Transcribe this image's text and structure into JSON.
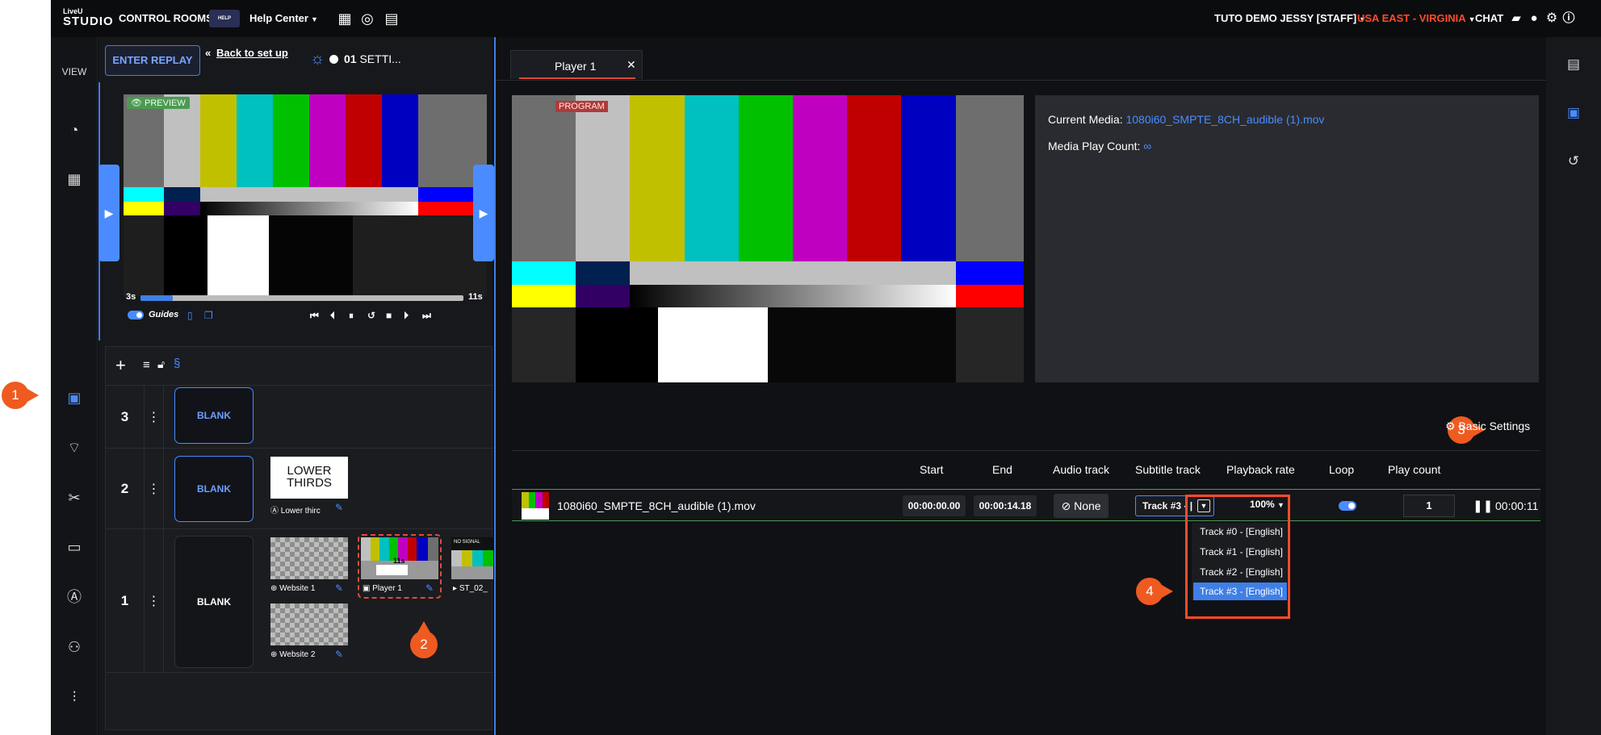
{
  "topbar": {
    "logo_top": "LiveU",
    "logo_bottom": "STUDIO",
    "control_rooms": "CONTROL ROOMS",
    "hc_badge": "HELP",
    "help_center": "Help Center",
    "user": "TUTO DEMO JESSY [STAFF]",
    "region": "USA EAST - VIRGINIA",
    "chat": "CHAT"
  },
  "rail": {
    "view_label": "VIEW",
    "icons": [
      "dashboard-icon",
      "layout-icon",
      "camera-icon",
      "broadcast-icon",
      "scissors-icon",
      "caption-icon",
      "text-icon",
      "users-icon",
      "sliders-icon"
    ]
  },
  "mid": {
    "enter_replay": "ENTER REPLAY",
    "back_to_set": "Back to set up",
    "scene_number": "01",
    "scene_name": "SETTI...",
    "preview_tag": "PREVIEW",
    "progress": {
      "current": "3s",
      "total": "11s",
      "fraction": 0.1
    },
    "guides_label": "Guides",
    "layers": [
      {
        "num": "3",
        "blank": "BLANK"
      },
      {
        "num": "2",
        "blank": "BLANK",
        "lower_thirds_title": "LOWER THIRDS",
        "lower_thirds_label": "Lower thirc"
      },
      {
        "num": "1",
        "blank": "BLANK",
        "website1": "Website 1",
        "website2": "Website 2",
        "player1": "Player 1",
        "player1_time": "11s",
        "st_label": "ST_02_",
        "no_signal": "NO SIGNAL"
      }
    ]
  },
  "player": {
    "tab_label": "Player 1",
    "program_tag": "PROGRAM",
    "current_media_label": "Current Media:",
    "current_media_value": "1080i60_SMPTE_8CH_audible (1).mov",
    "play_count_label": "Media Play Count:",
    "play_count_value": "∞",
    "basic_settings": "Basic Settings",
    "columns": {
      "start": "Start",
      "end": "End",
      "audio": "Audio track",
      "subtitle": "Subtitle track",
      "rate": "Playback rate",
      "loop": "Loop",
      "count": "Play count"
    },
    "row": {
      "filename": "1080i60_SMPTE_8CH_audible (1).mov",
      "start": "00:00:00.00",
      "end": "00:00:14.18",
      "audio": "None",
      "subtitle": "Track #3 - |",
      "rate": "100%",
      "count": "1",
      "time_left": "00:00:11"
    },
    "subtitle_options": [
      "Track #0 - [English]",
      "Track #1 - [English]",
      "Track #2 - [English]",
      "Track #3 - [English]"
    ],
    "selected_subtitle_index": 3
  },
  "callouts": [
    "1",
    "2",
    "3",
    "4"
  ],
  "colors": {
    "accent": "#4a8cff",
    "callout": "#ef5a20",
    "highlight": "#ff4b2b"
  }
}
